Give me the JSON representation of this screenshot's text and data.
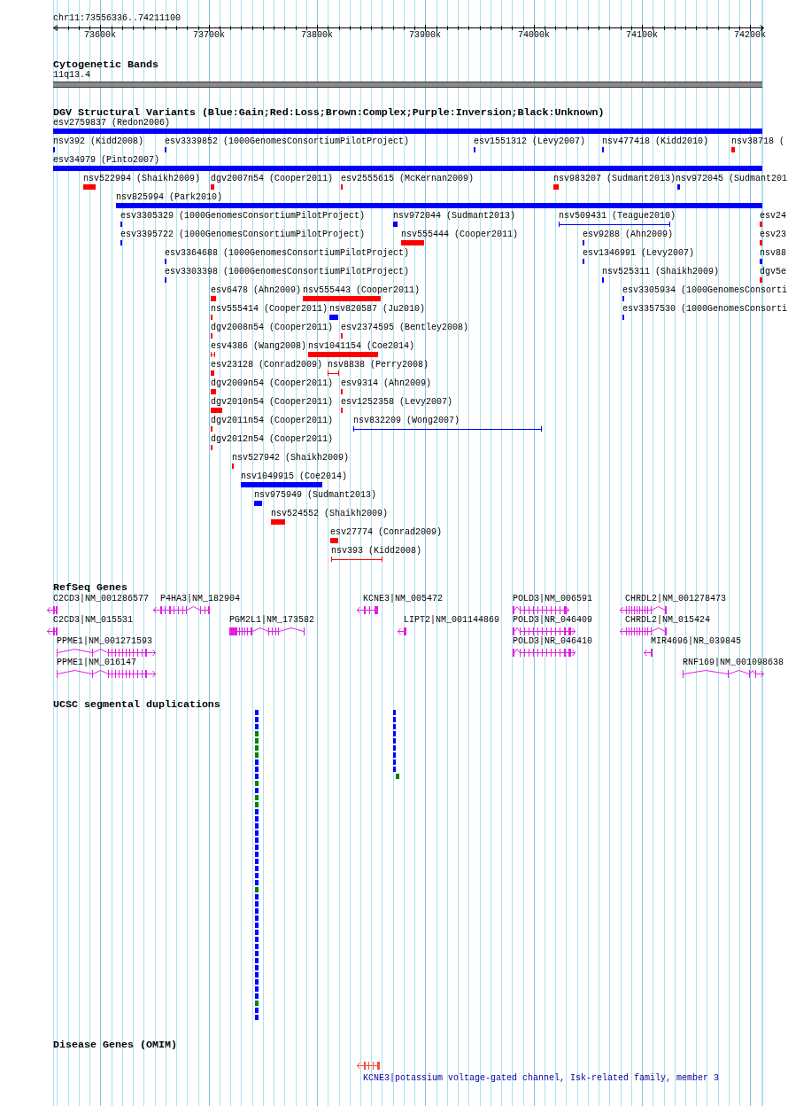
{
  "ruler": {
    "title": "chr11:73556336..74211100",
    "ticks": [
      "73600k",
      "73700k",
      "73800k",
      "73900k",
      "74000k",
      "74100k",
      "74200k"
    ]
  },
  "cytogenetic_bands": {
    "title": "Cytogenetic Bands",
    "bands": [
      {
        "label": "11q13.4"
      }
    ]
  },
  "dgv_structural_variants": {
    "title": "DGV Structural Variants (Blue:Gain;Red:Loss;Brown:Complex;Purple:Inversion;Black:Unknown)",
    "rows": [
      {
        "features": [
          {
            "label": "esv2759837 (Redon2006)",
            "kind": "bar",
            "color": "#0000ff"
          }
        ]
      },
      {
        "features": [
          {
            "label": "nsv392 (Kidd2008)",
            "kind": "bar",
            "color": "#0000ff"
          },
          {
            "label": "esv3339852 (1000GenomesConsortiumPilotProject)",
            "kind": "bar",
            "color": "#0000ff"
          },
          {
            "label": "esv1551312 (Levy2007)",
            "kind": "bar",
            "color": "#0000ff"
          },
          {
            "label": "nsv477418 (Kidd2010)",
            "kind": "bar",
            "color": "#0000ff"
          },
          {
            "label": "nsv38718 (",
            "kind": "bar",
            "color": "#ff0000"
          }
        ]
      },
      {
        "features": [
          {
            "label": "esv34979 (Pinto2007)",
            "kind": "bar",
            "color": "#0000ff"
          }
        ]
      },
      {
        "features": [
          {
            "label": "nsv522994 (Shaikh2009)",
            "kind": "bar",
            "color": "#ff0000"
          },
          {
            "label": "dgv2007n54 (Cooper2011)",
            "kind": "bar",
            "color": "#ff0000"
          },
          {
            "label": "esv2555615 (McKernan2009)",
            "kind": "bar",
            "color": "#ff0000"
          },
          {
            "label": "nsv983207 (Sudmant2013)",
            "kind": "bar",
            "color": "#ff0000"
          },
          {
            "label": "nsv972045 (Sudmant201",
            "kind": "bar",
            "color": "#0000ff"
          }
        ]
      },
      {
        "features": [
          {
            "label": "nsv825994 (Park2010)",
            "kind": "bar",
            "color": "#0000ff"
          }
        ]
      },
      {
        "features": [
          {
            "label": "esv3305329 (1000GenomesConsortiumPilotProject)",
            "kind": "bar",
            "color": "#0000ff"
          },
          {
            "label": "nsv972044 (Sudmant2013)",
            "kind": "bar",
            "color": "#0000ff"
          },
          {
            "label": "nsv509431 (Teague2010)",
            "kind": "interval",
            "color": "#0000ff"
          },
          {
            "label": "esv24",
            "kind": "bar",
            "color": "#ff0000"
          }
        ]
      },
      {
        "features": [
          {
            "label": "esv3395722 (1000GenomesConsortiumPilotProject)",
            "kind": "bar",
            "color": "#0000ff"
          },
          {
            "label": "nsv555444 (Cooper2011)",
            "kind": "bar",
            "color": "#ff0000"
          },
          {
            "label": "esv9288 (Ahn2009)",
            "kind": "bar",
            "color": "#0000ff"
          },
          {
            "label": "esv23",
            "kind": "bar",
            "color": "#ff0000"
          }
        ]
      },
      {
        "features": [
          {
            "label": "esv3364688 (1000GenomesConsortiumPilotProject)",
            "kind": "bar",
            "color": "#0000ff"
          },
          {
            "label": "esv1346991 (Levy2007)",
            "kind": "bar",
            "color": "#0000ff"
          },
          {
            "label": "nsv88",
            "kind": "bar",
            "color": "#0000ff"
          }
        ]
      },
      {
        "features": [
          {
            "label": "esv3303398 (1000GenomesConsortiumPilotProject)",
            "kind": "bar",
            "color": "#0000ff"
          },
          {
            "label": "nsv525311 (Shaikh2009)",
            "kind": "bar",
            "color": "#0000ff"
          },
          {
            "label": "dgv5e",
            "kind": "bar",
            "color": "#ff0000"
          }
        ]
      },
      {
        "features": [
          {
            "label": "esv6478 (Ahn2009)",
            "kind": "bar",
            "color": "#ff0000"
          },
          {
            "label": "nsv555443 (Cooper2011)",
            "kind": "bar",
            "color": "#ff0000"
          },
          {
            "label": "esv3305934 (1000GenomesConsorti",
            "kind": "bar",
            "color": "#0000ff"
          }
        ]
      },
      {
        "features": [
          {
            "label": "nsv555414 (Cooper2011)",
            "kind": "bar",
            "color": "#ff0000"
          },
          {
            "label": "nsv820587 (Ju2010)",
            "kind": "bar",
            "color": "#0000ff"
          },
          {
            "label": "esv3357530 (1000GenomesConsorti",
            "kind": "bar",
            "color": "#0000ff"
          }
        ]
      },
      {
        "features": [
          {
            "label": "dgv2008n54 (Cooper2011)",
            "kind": "bar",
            "color": "#ff0000"
          },
          {
            "label": "esv2374595 (Bentley2008)",
            "kind": "bar",
            "color": "#ff0000"
          }
        ]
      },
      {
        "features": [
          {
            "label": "esv4386 (Wang2008)",
            "kind": "interval",
            "color": "#ff0000"
          },
          {
            "label": "nsv1041154 (Coe2014)",
            "kind": "bar",
            "color": "#ff0000"
          }
        ]
      },
      {
        "features": [
          {
            "label": "esv23128 (Conrad2009)",
            "kind": "bar",
            "color": "#ff0000"
          },
          {
            "label": "nsv8838 (Perry2008)",
            "kind": "interval",
            "color": "#ff0000"
          }
        ]
      },
      {
        "features": [
          {
            "label": "dgv2009n54 (Cooper2011)",
            "kind": "bar",
            "color": "#ff0000"
          },
          {
            "label": "esv9314 (Ahn2009)",
            "kind": "bar",
            "color": "#ff0000"
          }
        ]
      },
      {
        "features": [
          {
            "label": "dgv2010n54 (Cooper2011)",
            "kind": "bar",
            "color": "#ff0000"
          },
          {
            "label": "esv1252358 (Levy2007)",
            "kind": "bar",
            "color": "#ff0000"
          }
        ]
      },
      {
        "features": [
          {
            "label": "dgv2011n54 (Cooper2011)",
            "kind": "bar",
            "color": "#ff0000"
          },
          {
            "label": "nsv832209 (Wong2007)",
            "kind": "interval",
            "color": "#0000ff"
          }
        ]
      },
      {
        "features": [
          {
            "label": "dgv2012n54 (Cooper2011)",
            "kind": "bar",
            "color": "#ff0000"
          }
        ]
      },
      {
        "features": [
          {
            "label": "nsv527942 (Shaikh2009)",
            "kind": "bar",
            "color": "#ff0000"
          }
        ]
      },
      {
        "features": [
          {
            "label": "nsv1049915 (Coe2014)",
            "kind": "bar",
            "color": "#0000ff"
          }
        ]
      },
      {
        "features": [
          {
            "label": "nsv975949 (Sudmant2013)",
            "kind": "bar",
            "color": "#0000ff"
          }
        ]
      },
      {
        "features": [
          {
            "label": "nsv524552 (Shaikh2009)",
            "kind": "bar",
            "color": "#ff0000"
          }
        ]
      },
      {
        "features": [
          {
            "label": "esv27774 (Conrad2009)",
            "kind": "bar",
            "color": "#ff0000"
          }
        ]
      },
      {
        "features": [
          {
            "label": "nsv393 (Kidd2008)",
            "kind": "interval",
            "color": "#ff0000"
          }
        ]
      }
    ]
  },
  "refseq_genes": {
    "title": "RefSeq Genes",
    "rows": [
      {
        "genes": [
          {
            "label": "C2CD3|NM_001286577",
            "reverse_strand": true
          },
          {
            "label": "P4HA3|NM_182904",
            "reverse_strand": true
          },
          {
            "label": "KCNE3|NM_005472",
            "reverse_strand": true
          },
          {
            "label": "POLD3|NM_006591",
            "reverse_strand": false
          },
          {
            "label": "CHRDL2|NM_001278473",
            "reverse_strand": true
          }
        ]
      },
      {
        "genes": [
          {
            "label": "C2CD3|NM_015531",
            "reverse_strand": true
          },
          {
            "label": "PGM2L1|NM_173582",
            "reverse_strand": true
          },
          {
            "label": "LIPT2|NM_001144869",
            "reverse_strand": true
          },
          {
            "label": "POLD3|NR_046409",
            "reverse_strand": false
          },
          {
            "label": "CHRDL2|NM_015424",
            "reverse_strand": true
          }
        ]
      },
      {
        "genes": [
          {
            "label": "PPME1|NM_001271593",
            "reverse_strand": false
          },
          {
            "label": "POLD3|NR_046410",
            "reverse_strand": false
          },
          {
            "label": "MIR4696|NR_039845",
            "reverse_strand": true
          }
        ]
      },
      {
        "genes": [
          {
            "label": "PPME1|NM_016147",
            "reverse_strand": false
          },
          {
            "label": "RNF169|NM_001098638",
            "reverse_strand": false
          }
        ]
      }
    ]
  },
  "segmental_duplications": {
    "title": "UCSC segmental duplications",
    "columns": [
      {
        "blocks": [
          {
            "color": "#0000ff"
          },
          {
            "color": "#0000ff"
          },
          {
            "color": "#0000ff"
          },
          {
            "color": "#008000"
          },
          {
            "color": "#008000"
          },
          {
            "color": "#008000"
          },
          {
            "color": "#008000"
          },
          {
            "color": "#0000ff"
          },
          {
            "color": "#0000ff"
          },
          {
            "color": "#0000ff"
          },
          {
            "color": "#008000"
          },
          {
            "color": "#0000ff"
          },
          {
            "color": "#008000"
          },
          {
            "color": "#008000"
          },
          {
            "color": "#0000ff"
          },
          {
            "color": "#0000ff"
          },
          {
            "color": "#0000ff"
          },
          {
            "color": "#0000ff"
          },
          {
            "color": "#0000ff"
          },
          {
            "color": "#0000ff"
          },
          {
            "color": "#0000ff"
          },
          {
            "color": "#0000ff"
          },
          {
            "color": "#0000ff"
          },
          {
            "color": "#0000ff"
          },
          {
            "color": "#0000ff"
          },
          {
            "color": "#008000"
          },
          {
            "color": "#0000ff"
          },
          {
            "color": "#0000ff"
          },
          {
            "color": "#0000ff"
          },
          {
            "color": "#0000ff"
          },
          {
            "color": "#0000ff"
          },
          {
            "color": "#0000ff"
          },
          {
            "color": "#0000ff"
          },
          {
            "color": "#0000ff"
          },
          {
            "color": "#0000ff"
          },
          {
            "color": "#0000ff"
          },
          {
            "color": "#0000ff"
          },
          {
            "color": "#0000ff"
          },
          {
            "color": "#0000ff"
          },
          {
            "color": "#0000ff"
          },
          {
            "color": "#0000ff"
          },
          {
            "color": "#008000"
          },
          {
            "color": "#0000ff"
          },
          {
            "color": "#0000ff"
          }
        ]
      },
      {
        "blocks": [
          {
            "color": "#0000ff"
          },
          {
            "color": "#0000ff"
          },
          {
            "color": "#0000ff"
          },
          {
            "color": "#0000ff"
          },
          {
            "color": "#0000ff"
          },
          {
            "color": "#0000ff"
          },
          {
            "color": "#0000ff"
          },
          {
            "color": "#0000ff"
          },
          {
            "color": "#0000ff"
          },
          {
            "color": "#008000"
          }
        ]
      }
    ]
  },
  "disease_genes": {
    "title": "Disease Genes (OMIM)",
    "genes": [
      {
        "label": "KCNE3|potassium voltage-gated channel, Isk-related family, member 3",
        "reverse_strand": true
      }
    ]
  }
}
